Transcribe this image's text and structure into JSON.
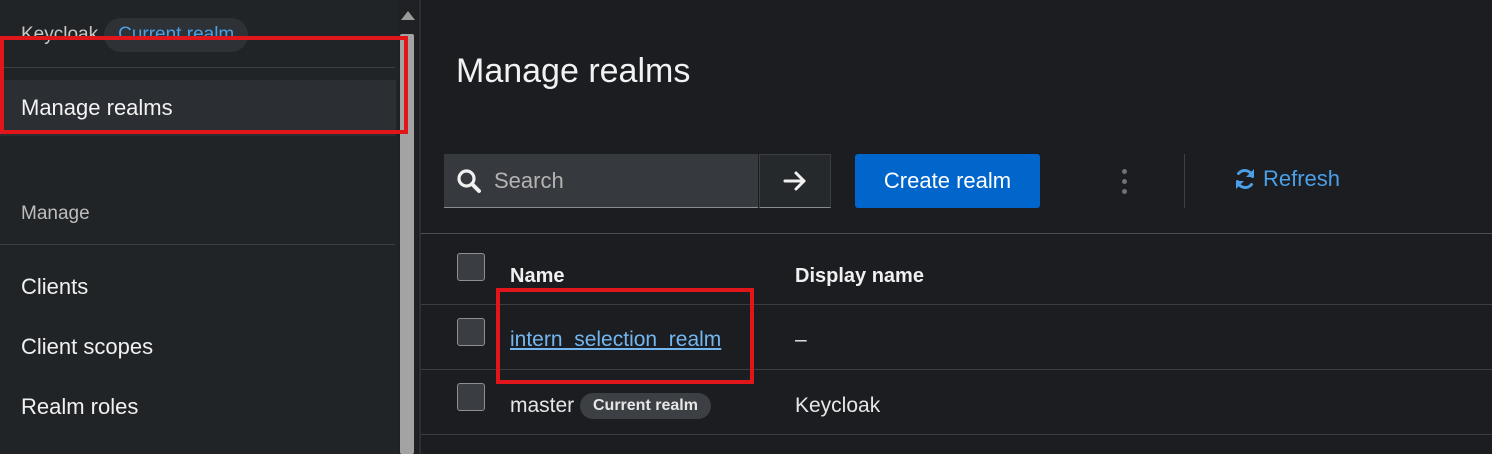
{
  "sidebar": {
    "realm_name": "Keycloak",
    "current_realm_pill": "Current realm",
    "manage_realms": "Manage realms",
    "section_title": "Manage",
    "items": [
      {
        "label": "Clients"
      },
      {
        "label": "Client scopes"
      },
      {
        "label": "Realm roles"
      }
    ]
  },
  "main": {
    "title": "Manage realms",
    "toolbar": {
      "search_placeholder": "Search",
      "create_label": "Create realm",
      "refresh_label": "Refresh"
    },
    "table": {
      "headers": {
        "name": "Name",
        "display_name": "Display name"
      },
      "rows": [
        {
          "name": "intern_selection_realm",
          "display_name": "–"
        },
        {
          "name": "master",
          "badge": "Current realm",
          "display_name": "Keycloak"
        }
      ]
    }
  },
  "colors": {
    "accent": "#0066cc",
    "link": "#73b6f0",
    "highlight": "#e0161b",
    "background": "#1b1d21",
    "sidebar": "#212427"
  },
  "icons": [
    "search-icon",
    "arrow-right-icon",
    "kebab-icon",
    "refresh-icon",
    "scroll-up-arrow-icon"
  ]
}
